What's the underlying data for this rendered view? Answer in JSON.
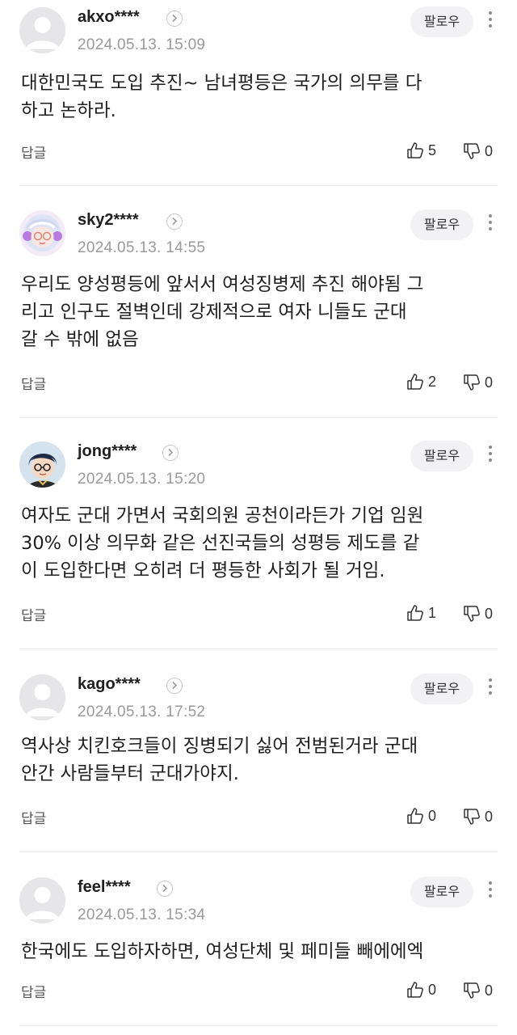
{
  "labels": {
    "follow": "팔로우",
    "reply": "답글"
  },
  "comments": [
    {
      "username": "akxo****",
      "timestamp": "2024.05.13. 15:09",
      "avatar": "default-avatar",
      "body": [
        "대한민국도 도입 추진~ 남녀평등은 국가의 의무를 다",
        "하고 논하라."
      ],
      "likes": "5",
      "dislikes": "0"
    },
    {
      "username": "sky2****",
      "timestamp": "2024.05.13. 14:55",
      "avatar": "character-avatar-glasses",
      "body": [
        "우리도 양성평등에 앞서서 여성징병제 추진 해야됨 그",
        "리고 인구도 절벽인데 강제적으로 여자 니들도 군대",
        "갈 수 밖에 없음"
      ],
      "likes": "2",
      "dislikes": "0"
    },
    {
      "username": "jong****",
      "timestamp": "2024.05.13. 15:20",
      "avatar": "character-avatar-boy",
      "body": [
        "여자도 군대 가면서 국회의원 공천이라든가 기업 임원",
        "30% 이상 의무화 같은 선진국들의 성평등 제도를 같",
        "이 도입한다면 오히려 더 평등한 사회가 될 거임."
      ],
      "likes": "1",
      "dislikes": "0"
    },
    {
      "username": "kago****",
      "timestamp": "2024.05.13. 17:52",
      "avatar": "default-avatar",
      "body": [
        "역사상 치킨호크들이 징병되기 싫어 전범된거라 군대",
        "안간 사람들부터 군대가야지."
      ],
      "likes": "0",
      "dislikes": "0"
    },
    {
      "username": "feel****",
      "timestamp": "2024.05.13. 15:34",
      "avatar": "default-avatar",
      "body": [
        "한국에도 도입하자하면, 여성단체 및 페미들 빼에에엑"
      ],
      "likes": "0",
      "dislikes": "0"
    }
  ]
}
